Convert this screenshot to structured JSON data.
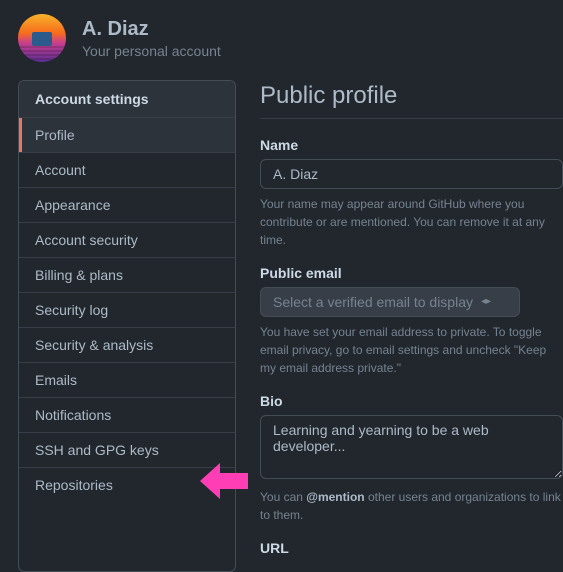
{
  "header": {
    "display_name": "A. Diaz",
    "subtitle": "Your personal account"
  },
  "sidebar": {
    "title": "Account settings",
    "items": [
      {
        "label": "Profile",
        "active": true
      },
      {
        "label": "Account",
        "active": false
      },
      {
        "label": "Appearance",
        "active": false
      },
      {
        "label": "Account security",
        "active": false
      },
      {
        "label": "Billing & plans",
        "active": false
      },
      {
        "label": "Security log",
        "active": false
      },
      {
        "label": "Security & analysis",
        "active": false
      },
      {
        "label": "Emails",
        "active": false
      },
      {
        "label": "Notifications",
        "active": false
      },
      {
        "label": "SSH and GPG keys",
        "active": false
      },
      {
        "label": "Repositories",
        "active": false
      }
    ]
  },
  "main": {
    "title": "Public profile",
    "name": {
      "label": "Name",
      "value": "A. Diaz",
      "help": "Your name may appear around GitHub where you contribute or are mentioned. You can remove it at any time."
    },
    "email": {
      "label": "Public email",
      "placeholder": "Select a verified email to display",
      "help_prefix": "You have set your email address to private. To toggle email privacy, go to email settings and uncheck \"Keep my email address private.\""
    },
    "bio": {
      "label": "Bio",
      "value": "Learning and yearning to be a web developer...",
      "help_pre": "You can ",
      "help_strong": "@mention",
      "help_post": " other users and organizations to link to them."
    },
    "url": {
      "label": "URL"
    }
  },
  "annotation": {
    "arrow_color": "#ff3eb5"
  }
}
